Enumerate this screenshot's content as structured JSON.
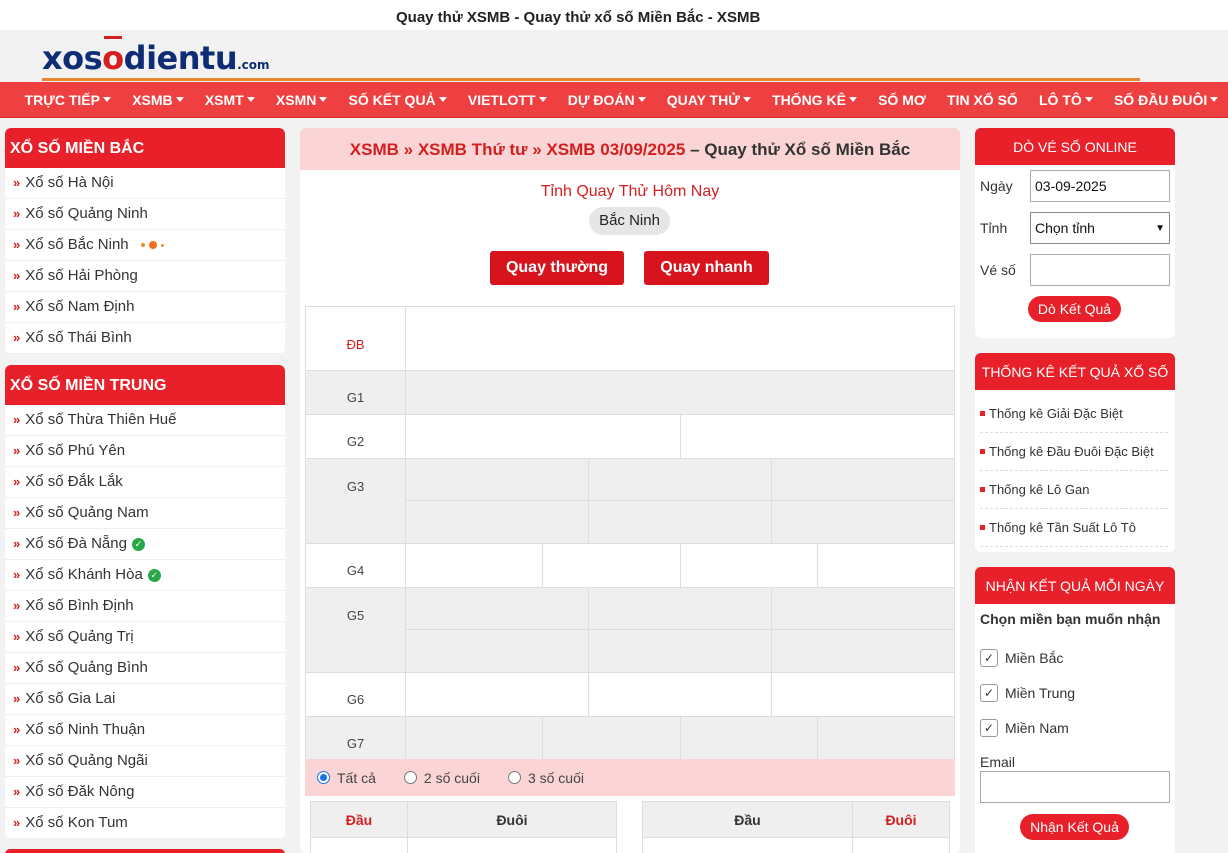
{
  "page_title": "Quay thử XSMB - Quay thử xổ số Miền Bắc - XSMB",
  "logo": {
    "part1": "xos",
    "o": "o",
    "part2": "dientu",
    "dom": ".com"
  },
  "nav": [
    {
      "label": "TRỰC TIẾP",
      "dd": true
    },
    {
      "label": "XSMB",
      "dd": true
    },
    {
      "label": "XSMT",
      "dd": true
    },
    {
      "label": "XSMN",
      "dd": true
    },
    {
      "label": "SỐ KẾT QUẢ",
      "dd": true
    },
    {
      "label": "VIETLOTT",
      "dd": true
    },
    {
      "label": "DỰ ĐOÁN",
      "dd": true
    },
    {
      "label": "QUAY THỬ",
      "dd": true
    },
    {
      "label": "THỐNG KÊ",
      "dd": true
    },
    {
      "label": "SỐ MƠ",
      "dd": false
    },
    {
      "label": "TIN XỔ SỐ",
      "dd": false
    },
    {
      "label": "LÔ TÔ",
      "dd": true
    },
    {
      "label": "SỐ ĐẦU ĐUÔI",
      "dd": true
    }
  ],
  "left": {
    "mb_title": "XỔ SỐ MIỀN BẮC",
    "mb": [
      "Xổ số Hà Nội",
      "Xổ số Quảng Ninh",
      "Xổ số Bắc Ninh",
      "Xổ số Hải Phòng",
      "Xổ số Nam Định",
      "Xổ số Thái Bình"
    ],
    "mt_title": "XỔ SỐ MIỀN TRUNG",
    "mt": [
      "Xổ số Thừa Thiên Huế",
      "Xổ số Phú Yên",
      "Xổ số Đắk Lắk",
      "Xổ số Quảng Nam",
      "Xổ số Đà Nẵng",
      "Xổ số Khánh Hòa",
      "Xổ số Bình Định",
      "Xổ số Quảng Trị",
      "Xổ số Quảng Bình",
      "Xổ số Gia Lai",
      "Xổ số Ninh Thuận",
      "Xổ số Quảng Ngãi",
      "Xổ số Đăk Nông",
      "Xổ số Kon Tum"
    ]
  },
  "center": {
    "bc1": "XSMB",
    "bc2": "XSMB Thứ tư",
    "bc3": "XSMB 03/09/2025",
    "bc_text": "– Quay thử Xổ số Miền Bắc",
    "subtitle": "Tỉnh Quay Thử Hôm Nay",
    "province": "Bắc Ninh",
    "btn_normal": "Quay thường",
    "btn_fast": "Quay nhanh",
    "prizes": {
      "db": "ĐB",
      "g1": "G1",
      "g2": "G2",
      "g3": "G3",
      "g4": "G4",
      "g5": "G5",
      "g6": "G6",
      "g7": "G7"
    },
    "radio_all": "Tất cả",
    "radio_2": "2 số cuối",
    "radio_3": "3 số cuối",
    "col_dau": "Đầu",
    "col_duoi": "Đuôi"
  },
  "right": {
    "do_title": "DÒ VÉ SỐ ONLINE",
    "ngay_label": "Ngày",
    "ngay_value": "03-09-2025",
    "tinh_label": "Tỉnh",
    "tinh_value": "Chọn tỉnh",
    "veso_label": "Vé số",
    "do_btn": "Dò Kết Quả",
    "tk_title": "THỐNG KÊ KẾT QUẢ XỔ SỐ",
    "tk": [
      "Thống kê Giải Đặc Biệt",
      "Thống kê Đầu Đuôi Đặc Biệt",
      "Thống kê Lô Gan",
      "Thống kê Tần Suất Lô Tô"
    ],
    "nk_title": "NHẬN KẾT QUẢ MỖI NGÀY",
    "nk_sub": "Chọn miền bạn muốn nhận",
    "regions": [
      "Miền Bắc",
      "Miền Trung",
      "Miền Nam"
    ],
    "email_label": "Email",
    "nk_btn": "Nhận Kết Quả"
  },
  "colors": {
    "primary_red": "#e8202a",
    "nav_red": "#ef4041",
    "light_pink": "#fbd5d6",
    "logo_blue": "#0e2d75"
  }
}
